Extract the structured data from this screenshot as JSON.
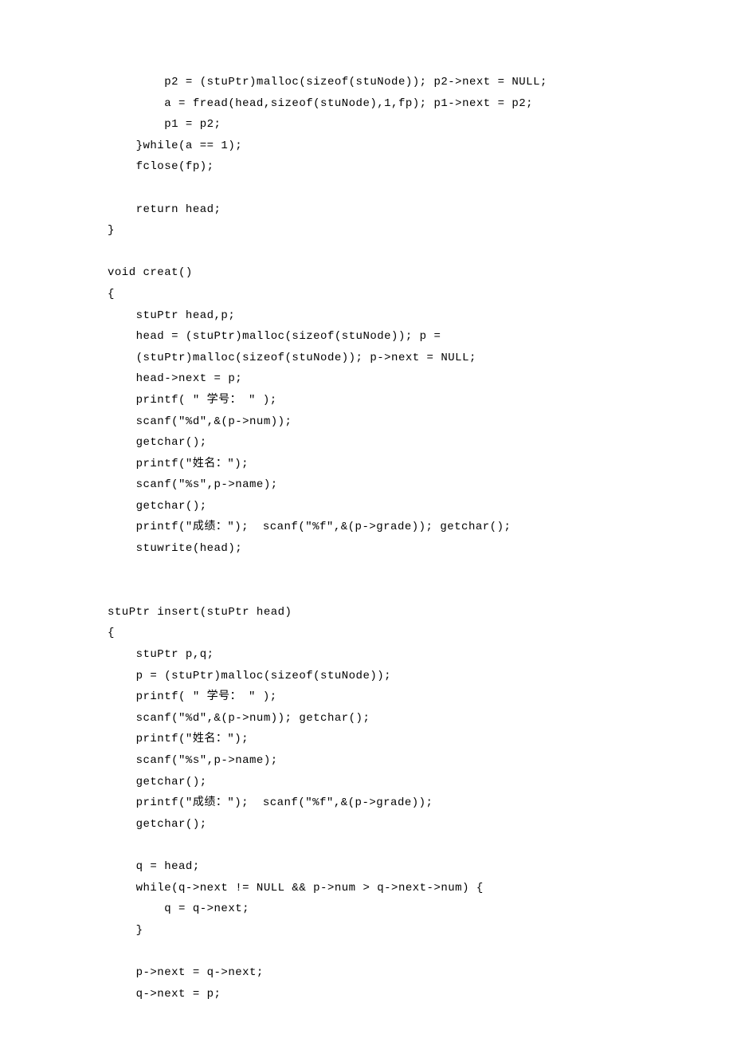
{
  "code_lines": [
    "        p2 = (stuPtr)malloc(sizeof(stuNode)); p2->next = NULL;",
    "        a = fread(head,sizeof(stuNode),1,fp); p1->next = p2;",
    "        p1 = p2;",
    "    }while(a == 1);",
    "    fclose(fp);",
    "",
    "    return head;",
    "}",
    "",
    "void creat()",
    "{",
    "    stuPtr head,p;",
    "    head = (stuPtr)malloc(sizeof(stuNode)); p =",
    "    (stuPtr)malloc(sizeof(stuNode)); p->next = NULL;",
    "    head->next = p;",
    "    printf( \" 学号： \" );",
    "    scanf(\"%d\",&(p->num));",
    "    getchar();",
    "    printf(\"姓名：\");",
    "    scanf(\"%s\",p->name);",
    "    getchar();",
    "    printf(\"成绩：\");  scanf(\"%f\",&(p->grade)); getchar();",
    "    stuwrite(head);",
    "",
    "",
    "stuPtr insert(stuPtr head)",
    "{",
    "    stuPtr p,q;",
    "    p = (stuPtr)malloc(sizeof(stuNode));",
    "    printf( \" 学号： \" );",
    "    scanf(\"%d\",&(p->num)); getchar();",
    "    printf(\"姓名：\");",
    "    scanf(\"%s\",p->name);",
    "    getchar();",
    "    printf(\"成绩：\");  scanf(\"%f\",&(p->grade));",
    "    getchar();",
    "",
    "    q = head;",
    "    while(q->next != NULL && p->num > q->next->num) {",
    "        q = q->next;",
    "    }",
    "",
    "    p->next = q->next;",
    "    q->next = p;"
  ]
}
